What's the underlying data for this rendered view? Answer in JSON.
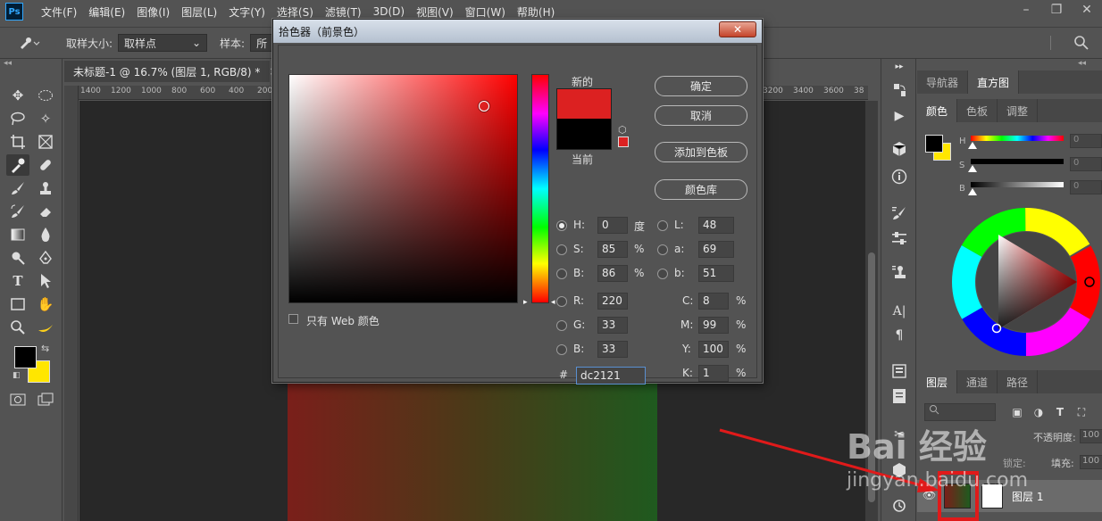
{
  "app": {
    "logo": "Ps",
    "menu": [
      "文件(F)",
      "编辑(E)",
      "图像(I)",
      "图层(L)",
      "文字(Y)",
      "选择(S)",
      "滤镜(T)",
      "3D(D)",
      "视图(V)",
      "窗口(W)",
      "帮助(H)"
    ],
    "window_buttons": [
      "–",
      "❐",
      "✕"
    ]
  },
  "options_bar": {
    "sample_size_label": "取样大小:",
    "sample_size_value": "取样点",
    "sample_label": "样本:",
    "sample_value": "所"
  },
  "document": {
    "tab_title": "未标题-1 @ 16.7% (图层 1, RGB/8) *",
    "tab_close": "×",
    "ruler_labels": [
      "1400",
      "1200",
      "1000",
      "800",
      "600",
      "400",
      "200",
      "3200",
      "3400",
      "3600",
      "38"
    ]
  },
  "color_picker": {
    "title": "拾色器（前景色）",
    "close": "✕",
    "label_new": "新的",
    "label_current": "当前",
    "btn_ok": "确定",
    "btn_cancel": "取消",
    "btn_add_swatch": "添加到色板",
    "btn_library": "颜色库",
    "web_only_label": "只有 Web 颜色",
    "fields": {
      "H": {
        "label": "H:",
        "value": "0",
        "unit": "度"
      },
      "S": {
        "label": "S:",
        "value": "85",
        "unit": "%"
      },
      "Bv": {
        "label": "B:",
        "value": "86",
        "unit": "%"
      },
      "R": {
        "label": "R:",
        "value": "220"
      },
      "G": {
        "label": "G:",
        "value": "33"
      },
      "Bl": {
        "label": "B:",
        "value": "33"
      },
      "L": {
        "label": "L:",
        "value": "48"
      },
      "a": {
        "label": "a:",
        "value": "69"
      },
      "b": {
        "label": "b:",
        "value": "51"
      },
      "C": {
        "label": "C:",
        "value": "8",
        "unit": "%"
      },
      "M": {
        "label": "M:",
        "value": "99",
        "unit": "%"
      },
      "Y": {
        "label": "Y:",
        "value": "100",
        "unit": "%"
      },
      "K": {
        "label": "K:",
        "value": "1",
        "unit": "%"
      }
    },
    "hex_label": "#",
    "hex_value": "dc2121",
    "new_color": "#dc2121",
    "current_color": "#000000"
  },
  "panels": {
    "top_tabs": [
      "导航器",
      "直方图"
    ],
    "color_tabs": [
      "颜色",
      "色板",
      "调整"
    ],
    "sliders": {
      "H": {
        "label": "H",
        "value": "0"
      },
      "S": {
        "label": "S",
        "value": "0"
      },
      "B": {
        "label": "B",
        "value": "0"
      }
    },
    "layer_tabs": [
      "图层",
      "通道",
      "路径"
    ],
    "opacity_label": "不透明度:",
    "opacity_value": "100",
    "fill_label": "填充:",
    "fill_value": "100",
    "lock_label": "锁定:",
    "layer_name": "图层 1"
  },
  "watermark": {
    "logo": "Bai 经验",
    "url": "jingyan.baidu.com"
  },
  "colors": {
    "foreground": "#000000",
    "background": "#ffe600",
    "highlight": "#e01a1a"
  }
}
